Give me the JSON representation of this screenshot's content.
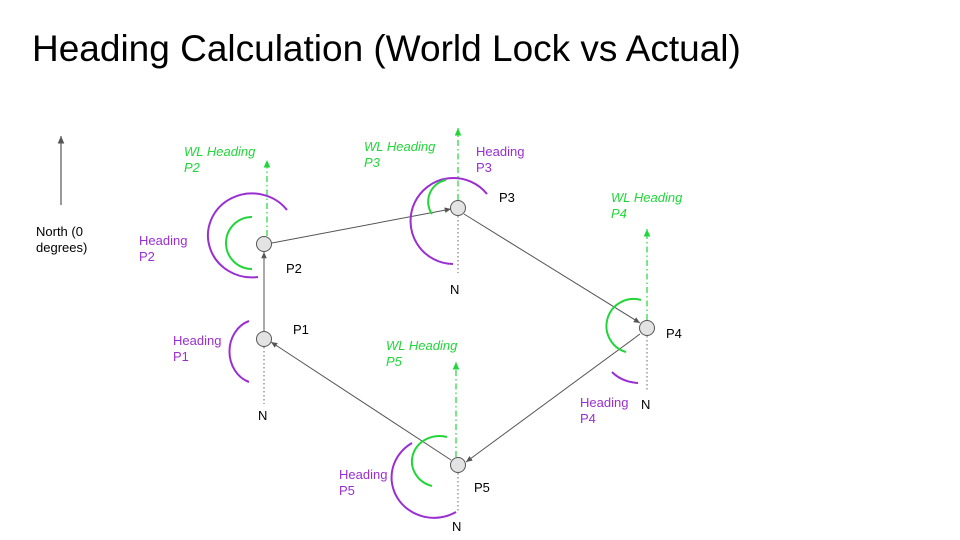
{
  "title": "Heading Calculation (World Lock vs Actual)",
  "colors": {
    "heading": "#9a2fd1",
    "wl_heading": "#22d63a",
    "path": "#555555"
  },
  "north_legend": [
    "North (0",
    "degrees)"
  ],
  "points": [
    {
      "id": "P1",
      "label": "P1",
      "heading": [
        "Heading",
        "P1"
      ],
      "north": "N"
    },
    {
      "id": "P2",
      "label": "P2",
      "heading": [
        "Heading",
        "P2"
      ],
      "wl_heading": [
        "WL Heading",
        "P2"
      ]
    },
    {
      "id": "P3",
      "label": "P3",
      "heading": [
        "Heading",
        "P3"
      ],
      "wl_heading": [
        "WL Heading",
        "P3"
      ],
      "north": "N"
    },
    {
      "id": "P4",
      "label": "P4",
      "heading": [
        "Heading",
        "P4"
      ],
      "wl_heading": [
        "WL Heading",
        "P4"
      ],
      "north": "N"
    },
    {
      "id": "P5",
      "label": "P5",
      "heading": [
        "Heading",
        "P5"
      ],
      "wl_heading": [
        "WL Heading",
        "P5"
      ],
      "north": "N"
    }
  ]
}
